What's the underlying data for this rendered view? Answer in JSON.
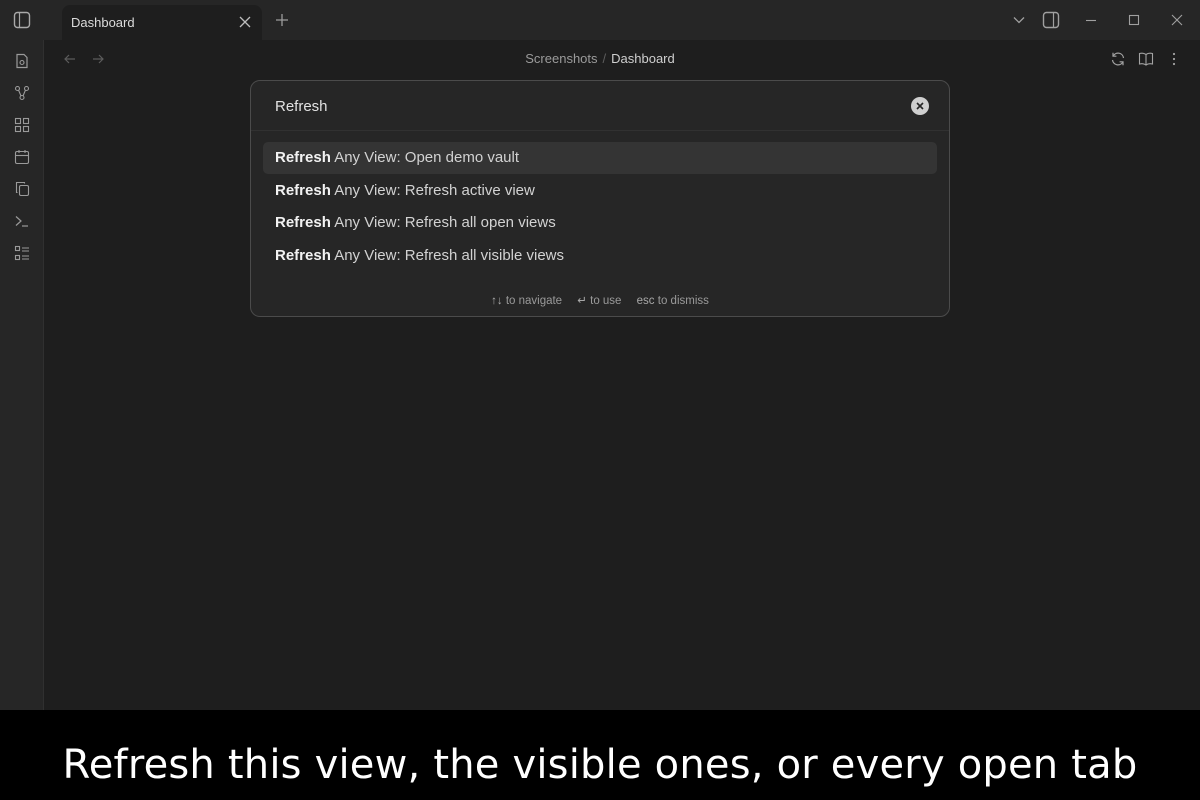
{
  "tab": {
    "title": "Dashboard"
  },
  "breadcrumb": {
    "parent": "Screenshots",
    "separator": "/",
    "current": "Dashboard"
  },
  "palette": {
    "query": "Refresh",
    "suggestions": [
      {
        "match": "Refresh",
        "rest": " Any View: Open demo vault",
        "selected": true
      },
      {
        "match": "Refresh",
        "rest": " Any View: Refresh active view",
        "selected": false
      },
      {
        "match": "Refresh",
        "rest": " Any View: Refresh all open views",
        "selected": false
      },
      {
        "match": "Refresh",
        "rest": " Any View: Refresh all visible views",
        "selected": false
      }
    ],
    "instructions": [
      {
        "key": "↑↓",
        "text": "to navigate"
      },
      {
        "key": "↵",
        "text": "to use"
      },
      {
        "key": "esc",
        "text": "to dismiss"
      }
    ]
  },
  "caption": "Refresh this view, the visible ones, or every open tab",
  "icons": {
    "titlebar": [
      "sidebar-toggle-icon",
      "close-icon",
      "plus-icon",
      "chevron-down-icon",
      "right-sidebar-icon",
      "minimize-icon",
      "maximize-icon",
      "close-window-icon"
    ],
    "ribbon": [
      "file-icon",
      "graph-icon",
      "blocks-icon",
      "calendar-icon",
      "copy-icon",
      "terminal-icon",
      "list-icon"
    ],
    "view_actions": [
      "refresh-icon",
      "book-open-icon",
      "more-vertical-icon"
    ]
  }
}
